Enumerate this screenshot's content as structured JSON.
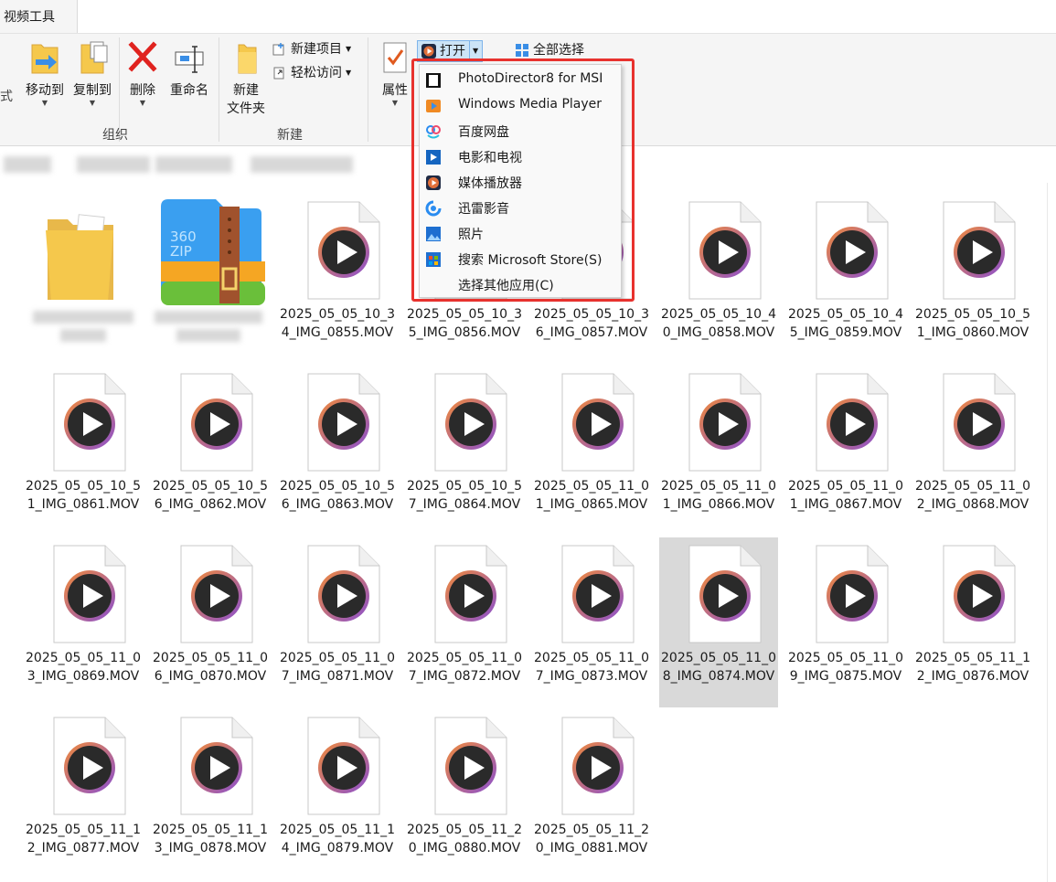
{
  "tabs": {
    "video_tools": "视频工具"
  },
  "ribbon": {
    "left_edge_text": "式",
    "move_to": "移动到",
    "copy_to": "复制到",
    "delete": "删除",
    "rename": "重命名",
    "group_organize": "组织",
    "new_folder_line1": "新建",
    "new_folder_line2": "文件夹",
    "new_item": "新建项目",
    "easy_access": "轻松访问",
    "group_new": "新建",
    "properties": "属性",
    "open": "打开",
    "select_all": "全部选择"
  },
  "open_menu": {
    "items": [
      {
        "label": "PhotoDirector8 for MSI",
        "icon": "photodirector-icon"
      },
      {
        "label": "Windows Media Player",
        "icon": "windows-media-player-icon"
      },
      {
        "label": "百度网盘",
        "icon": "baidu-netdisk-icon"
      },
      {
        "label": "电影和电视",
        "icon": "movies-tv-icon"
      },
      {
        "label": "媒体播放器",
        "icon": "media-player-icon"
      },
      {
        "label": "迅雷影音",
        "icon": "xunlei-player-icon"
      },
      {
        "label": "照片",
        "icon": "photos-icon"
      },
      {
        "label": "搜索 Microsoft Store(S)",
        "icon": "microsoft-store-icon"
      },
      {
        "label": "选择其他应用(C)",
        "icon": ""
      }
    ]
  },
  "files": [
    {
      "name": "2025_05_05_10_34_IMG_0855.MOV"
    },
    {
      "name": "2025_05_05_10_35_IMG_0856.MOV"
    },
    {
      "name": "2025_05_05_10_36_IMG_0857.MOV"
    },
    {
      "name": "2025_05_05_10_40_IMG_0858.MOV"
    },
    {
      "name": "2025_05_05_10_45_IMG_0859.MOV"
    },
    {
      "name": "2025_05_05_10_51_IMG_0860.MOV"
    },
    {
      "name": "2025_05_05_10_51_IMG_0861.MOV"
    },
    {
      "name": "2025_05_05_10_56_IMG_0862.MOV"
    },
    {
      "name": "2025_05_05_10_56_IMG_0863.MOV"
    },
    {
      "name": "2025_05_05_10_57_IMG_0864.MOV"
    },
    {
      "name": "2025_05_05_11_01_IMG_0865.MOV"
    },
    {
      "name": "2025_05_05_11_01_IMG_0866.MOV"
    },
    {
      "name": "2025_05_05_11_01_IMG_0867.MOV"
    },
    {
      "name": "2025_05_05_11_02_IMG_0868.MOV"
    },
    {
      "name": "2025_05_05_11_03_IMG_0869.MOV"
    },
    {
      "name": "2025_05_05_11_06_IMG_0870.MOV"
    },
    {
      "name": "2025_05_05_11_07_IMG_0871.MOV"
    },
    {
      "name": "2025_05_05_11_07_IMG_0872.MOV"
    },
    {
      "name": "2025_05_05_11_07_IMG_0873.MOV"
    },
    {
      "name": "2025_05_05_11_08_IMG_0874.MOV",
      "selected": true
    },
    {
      "name": "2025_05_05_11_09_IMG_0875.MOV"
    },
    {
      "name": "2025_05_05_11_12_IMG_0876.MOV"
    },
    {
      "name": "2025_05_05_11_12_IMG_0877.MOV"
    },
    {
      "name": "2025_05_05_11_13_IMG_0878.MOV"
    },
    {
      "name": "2025_05_05_11_14_IMG_0879.MOV"
    },
    {
      "name": "2025_05_05_11_20_IMG_0880.MOV"
    },
    {
      "name": "2025_05_05_11_20_IMG_0881.MOV"
    }
  ],
  "zip_text": "360 ZIP",
  "colors": {
    "highlight": "#e8322e",
    "selected_bg": "#d9d9d9",
    "folder": "#f5c84c"
  }
}
